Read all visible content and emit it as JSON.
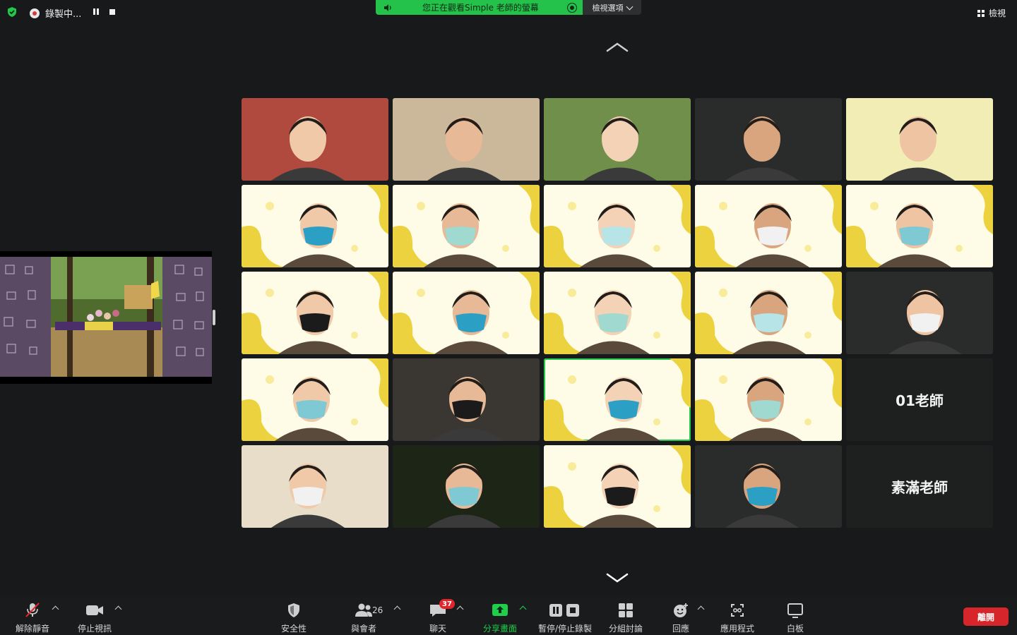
{
  "top": {
    "recording_label": "錄製中...",
    "share_banner": "您正在觀看Simple 老師的螢幕",
    "view_options": "檢視選項",
    "view_label": "檢視"
  },
  "tiles": [
    {
      "type": "video",
      "bg": "#b04a3e"
    },
    {
      "type": "video",
      "bg": "#cbb79a"
    },
    {
      "type": "video",
      "bg": "#6f8f4a"
    },
    {
      "type": "video",
      "bg": "#2a2c2b"
    },
    {
      "type": "video",
      "bg": "#f2ecb5"
    },
    {
      "type": "video",
      "bg": "#fefbe6"
    },
    {
      "type": "video",
      "bg": "#fefbe6"
    },
    {
      "type": "video",
      "bg": "#fefbe6"
    },
    {
      "type": "video",
      "bg": "#fefbe6"
    },
    {
      "type": "video",
      "bg": "#fefbe6"
    },
    {
      "type": "video",
      "bg": "#fefbe6"
    },
    {
      "type": "video",
      "bg": "#fefbe6"
    },
    {
      "type": "video",
      "bg": "#fefbe6"
    },
    {
      "type": "video",
      "bg": "#fefbe6"
    },
    {
      "type": "video",
      "bg": "#2a2c2b"
    },
    {
      "type": "video",
      "bg": "#fefbe6"
    },
    {
      "type": "video",
      "bg": "#3a3632"
    },
    {
      "type": "video",
      "bg": "#fefbe6",
      "active": true
    },
    {
      "type": "video",
      "bg": "#fefbe6"
    },
    {
      "type": "name",
      "label": "01老師"
    },
    {
      "type": "video",
      "bg": "#e7ddc8"
    },
    {
      "type": "video",
      "bg": "#1d2516"
    },
    {
      "type": "video",
      "bg": "#fefbe6"
    },
    {
      "type": "video",
      "bg": "#2a2c2b"
    },
    {
      "type": "name",
      "label": "素滿老師"
    }
  ],
  "toolbar": {
    "unmute": "解除靜音",
    "stop_video": "停止視訊",
    "security": "安全性",
    "participants": "與會者",
    "participants_count": "26",
    "chat": "聊天",
    "chat_badge": "37",
    "share_screen": "分享畫面",
    "pause_record": "暫停/停止錄製",
    "breakout": "分組討論",
    "reactions": "回應",
    "apps": "應用程式",
    "whiteboard": "白板",
    "leave": "離開"
  },
  "colors": {
    "accent_green": "#22c94b",
    "leave_red": "#d6262c"
  }
}
